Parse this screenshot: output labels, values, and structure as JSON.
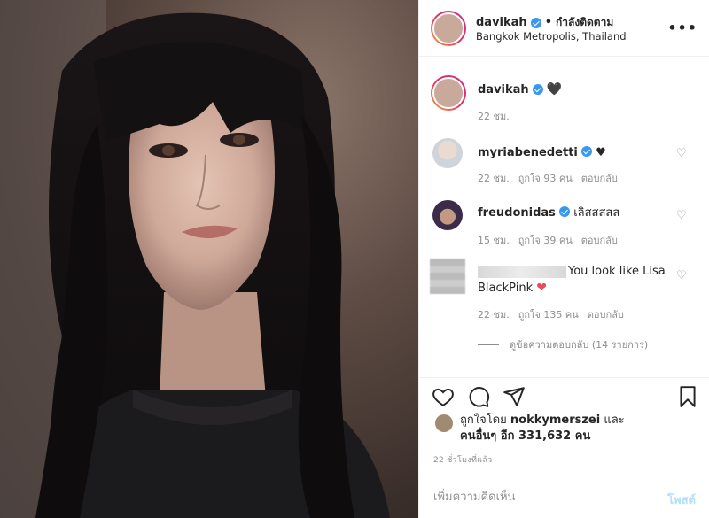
{
  "header": {
    "username": "davikah",
    "separator": "•",
    "follow_status": "กำลังติดตาม",
    "location": "Bangkok Metropolis, Thailand",
    "more": "•••"
  },
  "caption": {
    "username": "davikah",
    "emoji": "🖤",
    "time": "22 ชม."
  },
  "comments": [
    {
      "username": "myriabenedetti",
      "text": "♥",
      "time": "22 ชม.",
      "likes": "ถูกใจ 93 คน",
      "reply": "ตอบกลับ"
    },
    {
      "username": "freudonidas",
      "text": "เลิสสสสส",
      "time": "15 ชม.",
      "likes": "ถูกใจ 39 คน",
      "reply": "ตอบกลับ"
    },
    {
      "username": "",
      "text_line1": "You look like Lisa",
      "text_line2": "BlackPink",
      "emoji": "❤",
      "time": "22 ชม.",
      "likes": "ถูกใจ 135 คน",
      "reply": "ตอบกลับ"
    }
  ],
  "view_replies": "ดูข้อความตอบกลับ (14 รายการ)",
  "likes": {
    "prefix": "ถูกใจโดย",
    "user": "nokkymerszei",
    "and": "และ",
    "others": "คนอื่นๆ อีก 331,632 คน"
  },
  "post_time": "22 ชั่วโมงที่แล้ว",
  "add_comment": {
    "placeholder": "เพิ่มความคิดเห็น",
    "post_label": "โพสต์"
  },
  "colors": {
    "verified": "#3897f0",
    "muted": "#8e8e8e",
    "heart_red": "#ed4956",
    "post_disabled": "#b2dffc"
  }
}
